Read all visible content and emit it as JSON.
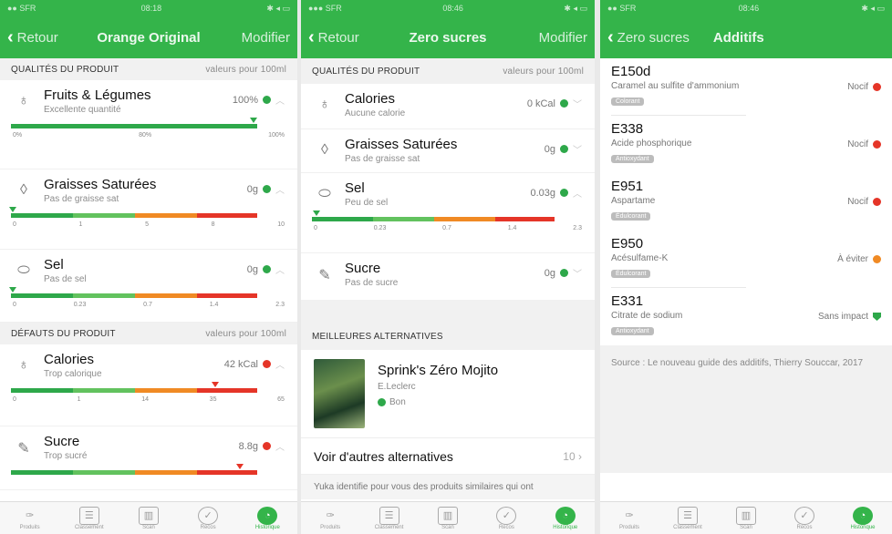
{
  "screen1": {
    "status": {
      "left": "●● SFR",
      "time": "08:18",
      "right": "✱ ◂ ▭"
    },
    "nav": {
      "back": "Retour",
      "title": "Orange Original",
      "right": "Modifier"
    },
    "qualities": {
      "title": "QUALITÉS DU PRODUIT",
      "sub": "valeurs pour 100ml"
    },
    "rows_top": [
      {
        "name": "Fruits & Légumes",
        "desc": "Excellente quantité",
        "value": "100%",
        "ticks": [
          "0%",
          "80%",
          "100%"
        ]
      },
      {
        "name": "Graisses Saturées",
        "desc": "Pas de graisse sat",
        "value": "0g",
        "ticks": [
          "0",
          "1",
          "5",
          "8",
          "10"
        ]
      },
      {
        "name": "Sel",
        "desc": "Pas de sel",
        "value": "0g",
        "ticks": [
          "0",
          "0.23",
          "0.7",
          "1.4",
          "2.3"
        ]
      }
    ],
    "defects": {
      "title": "DÉFAUTS DU PRODUIT",
      "sub": "valeurs pour 100ml"
    },
    "rows_bottom": [
      {
        "name": "Calories",
        "desc": "Trop calorique",
        "value": "42 kCal",
        "ticks": [
          "0",
          "1",
          "14",
          "35",
          "65"
        ]
      },
      {
        "name": "Sucre",
        "desc": "Trop sucré",
        "value": "8.8g"
      }
    ]
  },
  "screen2": {
    "status": {
      "left": "●●● SFR",
      "time": "08:46",
      "right": "✱ ◂ ▭"
    },
    "nav": {
      "back": "Retour",
      "title": "Zero sucres",
      "right": "Modifier"
    },
    "qualities": {
      "title": "QUALITÉS DU PRODUIT",
      "sub": "valeurs pour 100ml"
    },
    "rows": [
      {
        "name": "Calories",
        "desc": "Aucune calorie",
        "value": "0 kCal"
      },
      {
        "name": "Graisses Saturées",
        "desc": "Pas de graisse sat",
        "value": "0g"
      },
      {
        "name": "Sel",
        "desc": "Peu de sel",
        "value": "0.03g",
        "ticks": [
          "0",
          "0.23",
          "0.7",
          "1.4",
          "2.3"
        ]
      },
      {
        "name": "Sucre",
        "desc": "Pas de sucre",
        "value": "0g"
      }
    ],
    "alternatives": {
      "title": "MEILLEURES ALTERNATIVES",
      "name": "Sprink's Zéro Mojito",
      "brand": "E.Leclerc",
      "score": "Bon",
      "more": "Voir d'autres alternatives",
      "count": "10",
      "note": "Yuka identifie pour vous des produits similaires qui ont"
    }
  },
  "screen3": {
    "status": {
      "left": "●● SFR",
      "time": "08:46",
      "right": "✱ ◂ ▭"
    },
    "nav": {
      "back": "Zero sucres",
      "title": "Additifs"
    },
    "additives": [
      {
        "code": "E150d",
        "name": "Caramel au sulfite d'ammonium",
        "tag": "Colorant",
        "level": "Nocif"
      },
      {
        "code": "E338",
        "name": "Acide phosphorique",
        "tag": "Antioxydant",
        "level": "Nocif"
      },
      {
        "code": "E951",
        "name": "Aspartame",
        "tag": "Édulcorant",
        "level": "Nocif"
      },
      {
        "code": "E950",
        "name": "Acésulfame-K",
        "tag": "Édulcorant",
        "level": "À éviter"
      },
      {
        "code": "E331",
        "name": "Citrate de sodium",
        "tag": "Antioxydant",
        "level": "Sans impact"
      }
    ],
    "source": "Source : Le nouveau guide des additifs, Thierry Souccar, 2017"
  },
  "tabs": [
    "Produits",
    "Classement",
    "Scan",
    "Recos",
    "Historique"
  ],
  "colors": {
    "brand": "#34b44a",
    "good": "#2ea84a",
    "bad": "#e53528",
    "warn": "#f08a24"
  }
}
